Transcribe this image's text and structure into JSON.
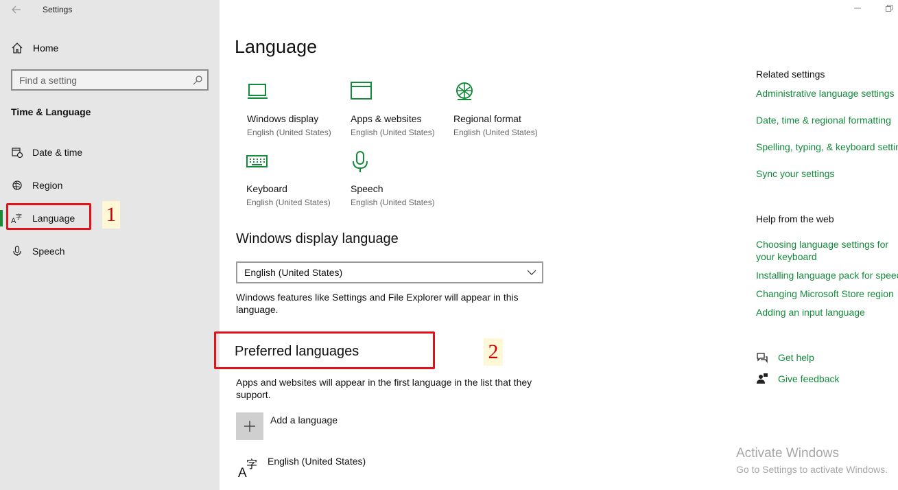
{
  "window": {
    "title": "Settings"
  },
  "sidebar": {
    "home_label": "Home",
    "search_placeholder": "Find a setting",
    "section_title": "Time & Language",
    "items": [
      {
        "label": "Date & time",
        "icon": "calendar-clock-icon"
      },
      {
        "label": "Region",
        "icon": "globe-icon"
      },
      {
        "label": "Language",
        "icon": "language-icon",
        "active": true
      },
      {
        "label": "Speech",
        "icon": "microphone-icon"
      }
    ]
  },
  "annotations": {
    "num1": "1",
    "num2": "2",
    "color": "#e0131a"
  },
  "main": {
    "title": "Language",
    "tiles": [
      {
        "name": "Windows display",
        "sub": "English (United States)",
        "icon": "monitor-icon"
      },
      {
        "name": "Apps & websites",
        "sub": "English (United States)",
        "icon": "browser-window-icon"
      },
      {
        "name": "Regional format",
        "sub": "English (United States)",
        "icon": "globe-format-icon"
      },
      {
        "name": "Keyboard",
        "sub": "English (United States)",
        "icon": "keyboard-icon"
      },
      {
        "name": "Speech",
        "sub": "English (United States)",
        "icon": "microphone-icon"
      }
    ],
    "display_language": {
      "heading": "Windows display language",
      "selected": "English (United States)",
      "description": "Windows features like Settings and File Explorer will appear in this language."
    },
    "preferred": {
      "heading": "Preferred languages",
      "description": "Apps and websites will appear in the first language in the list that they support.",
      "add_label": "Add a language",
      "languages": [
        "English (United States)"
      ]
    }
  },
  "right": {
    "related_heading": "Related settings",
    "related_links": [
      "Administrative language settings",
      "Date, time & regional formatting",
      "Spelling, typing, & keyboard settings",
      "Sync your settings"
    ],
    "help_heading": "Help from the web",
    "help_links": [
      "Choosing language settings for your keyboard",
      "Installing language pack for speech",
      "Changing Microsoft Store region",
      "Adding an input language"
    ],
    "get_help": "Get help",
    "give_feedback": "Give feedback"
  },
  "watermark": {
    "line1": "Activate Windows",
    "line2": "Go to Settings to activate Windows."
  },
  "colors": {
    "accent": "#138a3a",
    "sidebar_bg": "#e6e6e6"
  }
}
